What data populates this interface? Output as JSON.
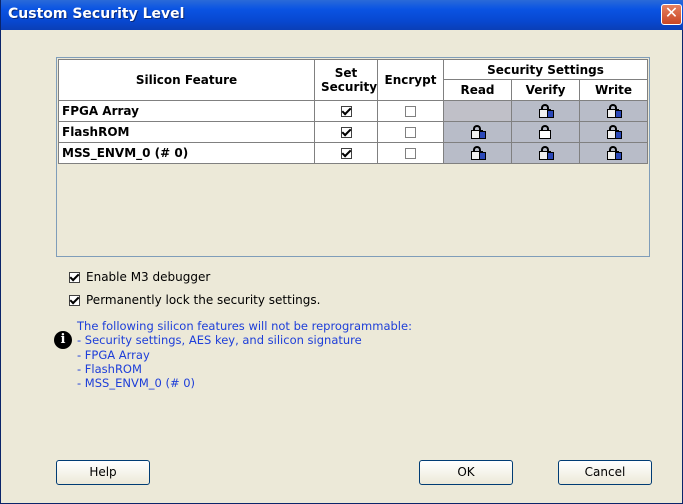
{
  "window": {
    "title": "Custom Security Level"
  },
  "table": {
    "headers": {
      "feature": "Silicon Feature",
      "set_security": "Set Security",
      "encrypt": "Encrypt",
      "security_settings": "Security Settings",
      "read": "Read",
      "verify": "Verify",
      "write": "Write"
    },
    "rows": [
      {
        "name": "FPGA Array",
        "set_security": true,
        "encrypt": false,
        "read": "none",
        "verify": "lock-icon",
        "write": "lock-icon"
      },
      {
        "name": "FlashROM",
        "set_security": true,
        "encrypt": false,
        "read": "lock-icon",
        "verify": "lock-plain-icon",
        "write": "lock-icon"
      },
      {
        "name": "MSS_ENVM_0 (# 0)",
        "set_security": true,
        "encrypt": false,
        "read": "lock-icon",
        "verify": "lock-icon",
        "write": "lock-icon"
      }
    ]
  },
  "options": {
    "enable_debugger": {
      "label": "Enable M3 debugger",
      "checked": true
    },
    "permanent_lock": {
      "label": "Permanently lock the security settings.",
      "checked": true
    }
  },
  "info": {
    "lines": [
      "The following silicon features will not be reprogrammable:",
      "- Security settings, AES key, and silicon signature",
      "- FPGA Array",
      "- FlashROM",
      "- MSS_ENVM_0 (# 0)"
    ]
  },
  "buttons": {
    "help": "Help",
    "ok": "OK",
    "cancel": "Cancel"
  },
  "colors": {
    "info_text": "#1d3ed9",
    "titlebar": "#0a54e3",
    "locked_cell": "#b8bcc8"
  }
}
